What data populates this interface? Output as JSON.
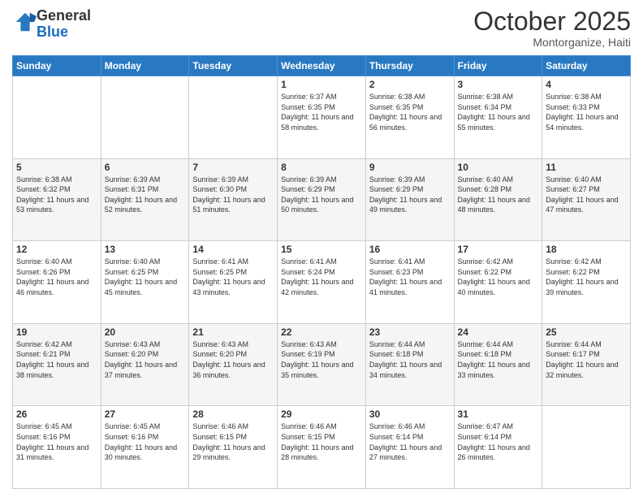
{
  "header": {
    "logo_general": "General",
    "logo_blue": "Blue",
    "month_title": "October 2025",
    "location": "Montorganize, Haiti"
  },
  "days_of_week": [
    "Sunday",
    "Monday",
    "Tuesday",
    "Wednesday",
    "Thursday",
    "Friday",
    "Saturday"
  ],
  "weeks": [
    [
      {
        "day": "",
        "sunrise": "",
        "sunset": "",
        "daylight": ""
      },
      {
        "day": "",
        "sunrise": "",
        "sunset": "",
        "daylight": ""
      },
      {
        "day": "",
        "sunrise": "",
        "sunset": "",
        "daylight": ""
      },
      {
        "day": "1",
        "sunrise": "Sunrise: 6:37 AM",
        "sunset": "Sunset: 6:35 PM",
        "daylight": "Daylight: 11 hours and 58 minutes."
      },
      {
        "day": "2",
        "sunrise": "Sunrise: 6:38 AM",
        "sunset": "Sunset: 6:35 PM",
        "daylight": "Daylight: 11 hours and 56 minutes."
      },
      {
        "day": "3",
        "sunrise": "Sunrise: 6:38 AM",
        "sunset": "Sunset: 6:34 PM",
        "daylight": "Daylight: 11 hours and 55 minutes."
      },
      {
        "day": "4",
        "sunrise": "Sunrise: 6:38 AM",
        "sunset": "Sunset: 6:33 PM",
        "daylight": "Daylight: 11 hours and 54 minutes."
      }
    ],
    [
      {
        "day": "5",
        "sunrise": "Sunrise: 6:38 AM",
        "sunset": "Sunset: 6:32 PM",
        "daylight": "Daylight: 11 hours and 53 minutes."
      },
      {
        "day": "6",
        "sunrise": "Sunrise: 6:39 AM",
        "sunset": "Sunset: 6:31 PM",
        "daylight": "Daylight: 11 hours and 52 minutes."
      },
      {
        "day": "7",
        "sunrise": "Sunrise: 6:39 AM",
        "sunset": "Sunset: 6:30 PM",
        "daylight": "Daylight: 11 hours and 51 minutes."
      },
      {
        "day": "8",
        "sunrise": "Sunrise: 6:39 AM",
        "sunset": "Sunset: 6:29 PM",
        "daylight": "Daylight: 11 hours and 50 minutes."
      },
      {
        "day": "9",
        "sunrise": "Sunrise: 6:39 AM",
        "sunset": "Sunset: 6:29 PM",
        "daylight": "Daylight: 11 hours and 49 minutes."
      },
      {
        "day": "10",
        "sunrise": "Sunrise: 6:40 AM",
        "sunset": "Sunset: 6:28 PM",
        "daylight": "Daylight: 11 hours and 48 minutes."
      },
      {
        "day": "11",
        "sunrise": "Sunrise: 6:40 AM",
        "sunset": "Sunset: 6:27 PM",
        "daylight": "Daylight: 11 hours and 47 minutes."
      }
    ],
    [
      {
        "day": "12",
        "sunrise": "Sunrise: 6:40 AM",
        "sunset": "Sunset: 6:26 PM",
        "daylight": "Daylight: 11 hours and 46 minutes."
      },
      {
        "day": "13",
        "sunrise": "Sunrise: 6:40 AM",
        "sunset": "Sunset: 6:25 PM",
        "daylight": "Daylight: 11 hours and 45 minutes."
      },
      {
        "day": "14",
        "sunrise": "Sunrise: 6:41 AM",
        "sunset": "Sunset: 6:25 PM",
        "daylight": "Daylight: 11 hours and 43 minutes."
      },
      {
        "day": "15",
        "sunrise": "Sunrise: 6:41 AM",
        "sunset": "Sunset: 6:24 PM",
        "daylight": "Daylight: 11 hours and 42 minutes."
      },
      {
        "day": "16",
        "sunrise": "Sunrise: 6:41 AM",
        "sunset": "Sunset: 6:23 PM",
        "daylight": "Daylight: 11 hours and 41 minutes."
      },
      {
        "day": "17",
        "sunrise": "Sunrise: 6:42 AM",
        "sunset": "Sunset: 6:22 PM",
        "daylight": "Daylight: 11 hours and 40 minutes."
      },
      {
        "day": "18",
        "sunrise": "Sunrise: 6:42 AM",
        "sunset": "Sunset: 6:22 PM",
        "daylight": "Daylight: 11 hours and 39 minutes."
      }
    ],
    [
      {
        "day": "19",
        "sunrise": "Sunrise: 6:42 AM",
        "sunset": "Sunset: 6:21 PM",
        "daylight": "Daylight: 11 hours and 38 minutes."
      },
      {
        "day": "20",
        "sunrise": "Sunrise: 6:43 AM",
        "sunset": "Sunset: 6:20 PM",
        "daylight": "Daylight: 11 hours and 37 minutes."
      },
      {
        "day": "21",
        "sunrise": "Sunrise: 6:43 AM",
        "sunset": "Sunset: 6:20 PM",
        "daylight": "Daylight: 11 hours and 36 minutes."
      },
      {
        "day": "22",
        "sunrise": "Sunrise: 6:43 AM",
        "sunset": "Sunset: 6:19 PM",
        "daylight": "Daylight: 11 hours and 35 minutes."
      },
      {
        "day": "23",
        "sunrise": "Sunrise: 6:44 AM",
        "sunset": "Sunset: 6:18 PM",
        "daylight": "Daylight: 11 hours and 34 minutes."
      },
      {
        "day": "24",
        "sunrise": "Sunrise: 6:44 AM",
        "sunset": "Sunset: 6:18 PM",
        "daylight": "Daylight: 11 hours and 33 minutes."
      },
      {
        "day": "25",
        "sunrise": "Sunrise: 6:44 AM",
        "sunset": "Sunset: 6:17 PM",
        "daylight": "Daylight: 11 hours and 32 minutes."
      }
    ],
    [
      {
        "day": "26",
        "sunrise": "Sunrise: 6:45 AM",
        "sunset": "Sunset: 6:16 PM",
        "daylight": "Daylight: 11 hours and 31 minutes."
      },
      {
        "day": "27",
        "sunrise": "Sunrise: 6:45 AM",
        "sunset": "Sunset: 6:16 PM",
        "daylight": "Daylight: 11 hours and 30 minutes."
      },
      {
        "day": "28",
        "sunrise": "Sunrise: 6:46 AM",
        "sunset": "Sunset: 6:15 PM",
        "daylight": "Daylight: 11 hours and 29 minutes."
      },
      {
        "day": "29",
        "sunrise": "Sunrise: 6:46 AM",
        "sunset": "Sunset: 6:15 PM",
        "daylight": "Daylight: 11 hours and 28 minutes."
      },
      {
        "day": "30",
        "sunrise": "Sunrise: 6:46 AM",
        "sunset": "Sunset: 6:14 PM",
        "daylight": "Daylight: 11 hours and 27 minutes."
      },
      {
        "day": "31",
        "sunrise": "Sunrise: 6:47 AM",
        "sunset": "Sunset: 6:14 PM",
        "daylight": "Daylight: 11 hours and 26 minutes."
      },
      {
        "day": "",
        "sunrise": "",
        "sunset": "",
        "daylight": ""
      }
    ]
  ]
}
